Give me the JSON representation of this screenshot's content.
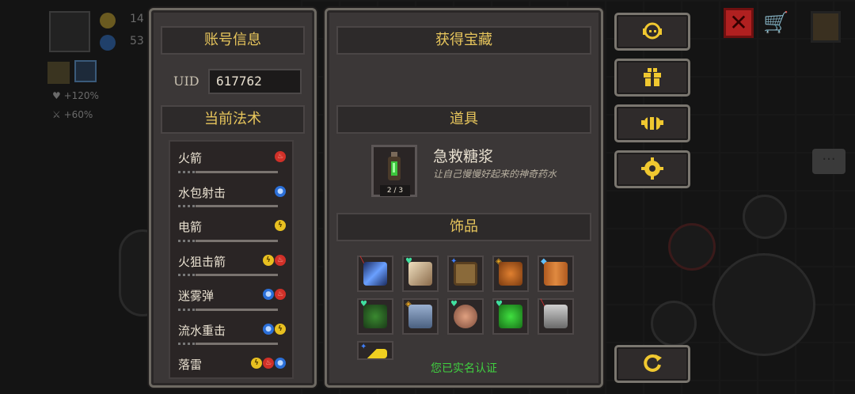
{
  "background": {
    "stat_1": "14",
    "stat_2": "53",
    "buff_1": "+120%",
    "buff_2": "+60%"
  },
  "account": {
    "header": "账号信息",
    "uid_label": "UID",
    "uid_value": "617762"
  },
  "spells": {
    "header": "当前法术",
    "items": [
      {
        "name": "火箭",
        "elements": [
          "fire"
        ]
      },
      {
        "name": "水包射击",
        "elements": [
          "water"
        ]
      },
      {
        "name": "电箭",
        "elements": [
          "thunder"
        ]
      },
      {
        "name": "火狙击箭",
        "elements": [
          "thunder",
          "fire"
        ]
      },
      {
        "name": "迷雾弹",
        "elements": [
          "water",
          "fire"
        ]
      },
      {
        "name": "流水重击",
        "elements": [
          "water",
          "thunder"
        ]
      },
      {
        "name": "落雷",
        "elements": [
          "thunder",
          "fire",
          "water"
        ]
      }
    ]
  },
  "treasure": {
    "header": "获得宝藏",
    "items_header": "道具",
    "item": {
      "name": "急救糖浆",
      "desc": "让自己慢慢好起来的神奇药水",
      "count": "2 / 3"
    },
    "accessories_header": "饰品",
    "verified_text": "您已实名认证"
  },
  "sidebar": {
    "buttons": [
      "support-icon",
      "gift-icon",
      "bee-icon",
      "settings-icon",
      "refresh-icon"
    ]
  },
  "colors": {
    "panel_bg": "#3b3737",
    "header_text": "#e8c65c",
    "verified": "#40d040",
    "fire": "#d03028",
    "water": "#2b6fd8",
    "thunder": "#e8c020"
  }
}
